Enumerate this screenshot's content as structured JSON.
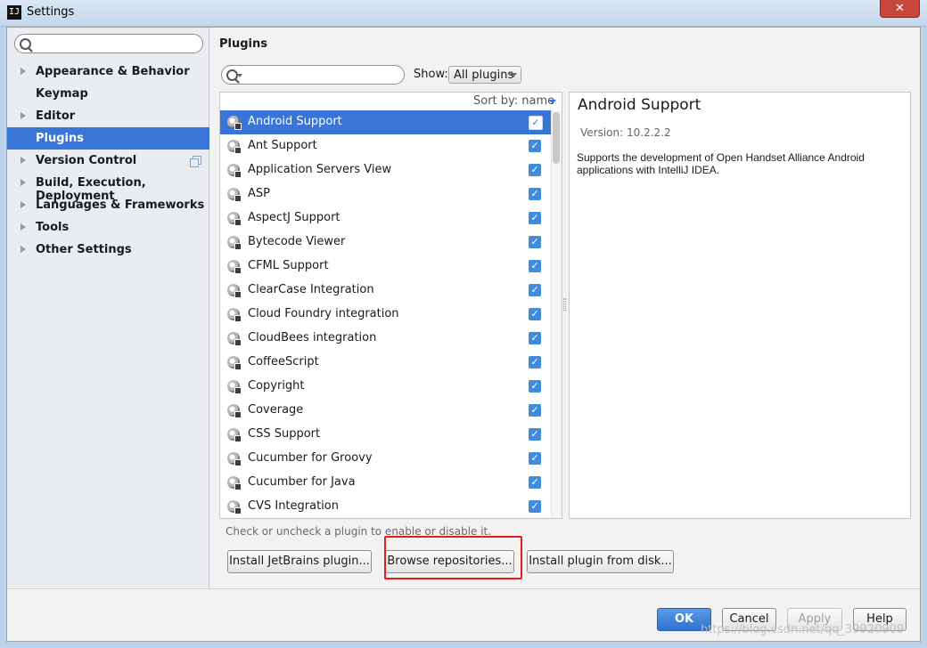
{
  "window": {
    "title": "Settings",
    "app_icon": "IJ"
  },
  "sidebar": {
    "search_placeholder": "",
    "items": [
      {
        "label": "Appearance & Behavior",
        "expandable": true,
        "selected": false
      },
      {
        "label": "Keymap",
        "expandable": false,
        "selected": false
      },
      {
        "label": "Editor",
        "expandable": true,
        "selected": false
      },
      {
        "label": "Plugins",
        "expandable": false,
        "selected": true
      },
      {
        "label": "Version Control",
        "expandable": true,
        "selected": false,
        "icon": "copy-icon"
      },
      {
        "label": "Build, Execution, Deployment",
        "expandable": true,
        "selected": false
      },
      {
        "label": "Languages & Frameworks",
        "expandable": true,
        "selected": false
      },
      {
        "label": "Tools",
        "expandable": true,
        "selected": false
      },
      {
        "label": "Other Settings",
        "expandable": true,
        "selected": false
      }
    ]
  },
  "main": {
    "title": "Plugins",
    "search_placeholder": "",
    "show_label": "Show:",
    "show_value": "All plugins",
    "sort_label": "Sort by: name",
    "plugins": [
      {
        "name": "Android Support",
        "enabled": true,
        "selected": true
      },
      {
        "name": "Ant Support",
        "enabled": true
      },
      {
        "name": "Application Servers View",
        "enabled": true
      },
      {
        "name": "ASP",
        "enabled": true
      },
      {
        "name": "AspectJ Support",
        "enabled": true
      },
      {
        "name": "Bytecode Viewer",
        "enabled": true
      },
      {
        "name": "CFML Support",
        "enabled": true
      },
      {
        "name": "ClearCase Integration",
        "enabled": true
      },
      {
        "name": "Cloud Foundry integration",
        "enabled": true
      },
      {
        "name": "CloudBees integration",
        "enabled": true
      },
      {
        "name": "CoffeeScript",
        "enabled": true
      },
      {
        "name": "Copyright",
        "enabled": true
      },
      {
        "name": "Coverage",
        "enabled": true
      },
      {
        "name": "CSS Support",
        "enabled": true
      },
      {
        "name": "Cucumber for Groovy",
        "enabled": true
      },
      {
        "name": "Cucumber for Java",
        "enabled": true
      },
      {
        "name": "CVS Integration",
        "enabled": true
      }
    ],
    "details": {
      "title": "Android Support",
      "version": "Version: 10.2.2.2",
      "description": "Supports the development of Open Handset Alliance Android applications with IntelliJ IDEA."
    },
    "hint": "Check or uncheck a plugin to enable or disable it.",
    "buttons": {
      "install_jetbrains": "Install JetBrains plugin...",
      "browse_repos": "Browse repositories...",
      "install_disk": "Install plugin from disk..."
    }
  },
  "footer": {
    "ok": "OK",
    "cancel": "Cancel",
    "apply": "Apply",
    "help": "Help"
  },
  "watermark": "https://blog.csdn.net/qq_39920909",
  "colors": {
    "accent": "#3875d7",
    "highlight": "#e02020",
    "checkbox": "#3f8bdc"
  }
}
